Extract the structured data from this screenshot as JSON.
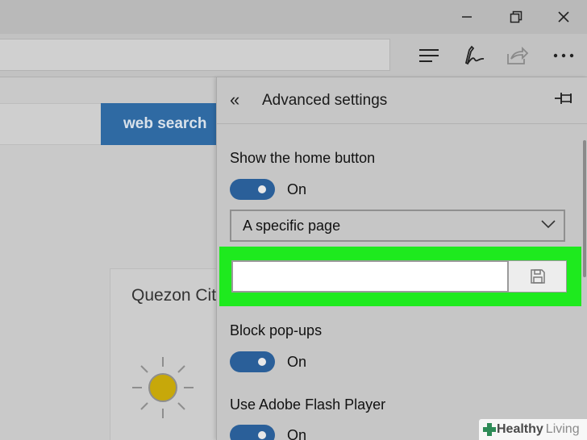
{
  "window": {
    "controls": [
      {
        "name": "minimize",
        "icon": "minimize-icon"
      },
      {
        "name": "restore",
        "icon": "restore-icon"
      },
      {
        "name": "close",
        "icon": "close-icon"
      }
    ]
  },
  "toolbar": {
    "icons": [
      "hub-icon",
      "web-note-icon",
      "share-icon",
      "more-icon"
    ]
  },
  "page": {
    "search_button_label": "web search",
    "weather_city": "Quezon City"
  },
  "panel": {
    "title": "Advanced settings",
    "back_icon": "«",
    "home_button": {
      "label": "Show the home button",
      "toggle_state": "On",
      "dropdown_value": "A specific page",
      "url_value": ""
    },
    "popups": {
      "label": "Block pop-ups",
      "toggle_state": "On"
    },
    "flash": {
      "label": "Use Adobe Flash Player",
      "toggle_state": "On"
    }
  },
  "colors": {
    "accent": "#2a5f99",
    "highlight": "#1eea1e",
    "search_button": "#2f6aa3"
  },
  "watermark": {
    "brand_a": "Healthy",
    "brand_b": "Living"
  }
}
